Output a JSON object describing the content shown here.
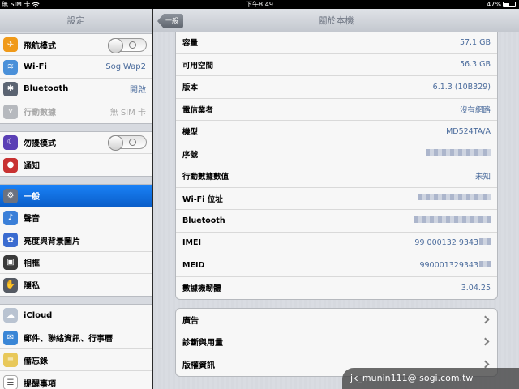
{
  "status_bar": {
    "carrier": "無 SIM 卡",
    "time": "下午8:49",
    "battery_percent": "47%",
    "icons": [
      "wifi-icon",
      "battery-icon"
    ]
  },
  "left": {
    "title": "設定",
    "groups": [
      [
        {
          "label": "飛航模式",
          "icon": "airplane-icon",
          "color": "#f09a1a",
          "glyph": "✈",
          "toggle": true,
          "toggle_state": "off"
        },
        {
          "label": "Wi-Fi",
          "icon": "wifi-icon",
          "color": "#4a90d9",
          "glyph": "≋",
          "value": "SogiWap2"
        },
        {
          "label": "Bluetooth",
          "icon": "bluetooth-icon",
          "color": "#5b6472",
          "glyph": "✱",
          "value": "開啟"
        },
        {
          "label": "行動數據",
          "icon": "cellular-data-icon",
          "color": "#b6b9be",
          "glyph": "⋎",
          "value": "無 SIM 卡",
          "disabled": true
        }
      ],
      [
        {
          "label": "勿擾模式",
          "icon": "do-not-disturb-icon",
          "color": "#5a3fb5",
          "glyph": "☾",
          "toggle": true,
          "toggle_state": "off"
        },
        {
          "label": "通知",
          "icon": "notifications-icon",
          "color": "#c83232",
          "glyph": "●"
        }
      ],
      [
        {
          "label": "一般",
          "icon": "general-gear-icon",
          "color": "#6c7280",
          "glyph": "⚙",
          "selected": true
        },
        {
          "label": "聲音",
          "icon": "sound-icon",
          "color": "#3a7fd8",
          "glyph": "♪"
        },
        {
          "label": "亮度與背景圖片",
          "icon": "brightness-icon",
          "color": "#3a6bd0",
          "glyph": "✿"
        },
        {
          "label": "相框",
          "icon": "picture-frame-icon",
          "color": "#3a3a3a",
          "glyph": "▣"
        },
        {
          "label": "隱私",
          "icon": "privacy-hand-icon",
          "color": "#555a63",
          "glyph": "✋"
        }
      ],
      [
        {
          "label": "iCloud",
          "icon": "icloud-icon",
          "color": "#b9c3d1",
          "glyph": "☁"
        },
        {
          "label": "郵件、聯絡資訊、行事曆",
          "icon": "mail-icon",
          "color": "#3a86d6",
          "glyph": "✉"
        },
        {
          "label": "備忘錄",
          "icon": "notes-icon",
          "color": "#e8c85a",
          "glyph": "≡"
        },
        {
          "label": "提醒事項",
          "icon": "reminders-icon",
          "color": "#ffffff",
          "glyph": "☰"
        }
      ]
    ]
  },
  "right": {
    "back_label": "一般",
    "title": "關於本機",
    "info_rows": [
      {
        "key": "容量",
        "value": "57.1 GB"
      },
      {
        "key": "可用空間",
        "value": "56.3 GB"
      },
      {
        "key": "版本",
        "value": "6.1.3 (10B329)"
      },
      {
        "key": "電信業者",
        "value": "沒有網路"
      },
      {
        "key": "機型",
        "value": "MD524TA/A"
      },
      {
        "key": "序號",
        "value": "",
        "blurred": true,
        "blur_width": 80
      },
      {
        "key": "行動數據數值",
        "value": "未知"
      },
      {
        "key": "Wi-Fi 位址",
        "value": "",
        "blurred": true,
        "blur_width": 90
      },
      {
        "key": "Bluetooth",
        "value": "",
        "blurred": true,
        "blur_width": 95
      },
      {
        "key": "IMEI",
        "value": "99 000132 9343",
        "blurred_tail": true
      },
      {
        "key": "MEID",
        "value": "990001329343",
        "blurred_tail": true
      },
      {
        "key": "數據機韌體",
        "value": "3.04.25"
      }
    ],
    "nav_rows": [
      {
        "key": "廣告"
      },
      {
        "key": "診斷與用量"
      },
      {
        "key": "版權資訊"
      }
    ]
  },
  "watermark": "jk_munin111@ sogi.com.tw"
}
